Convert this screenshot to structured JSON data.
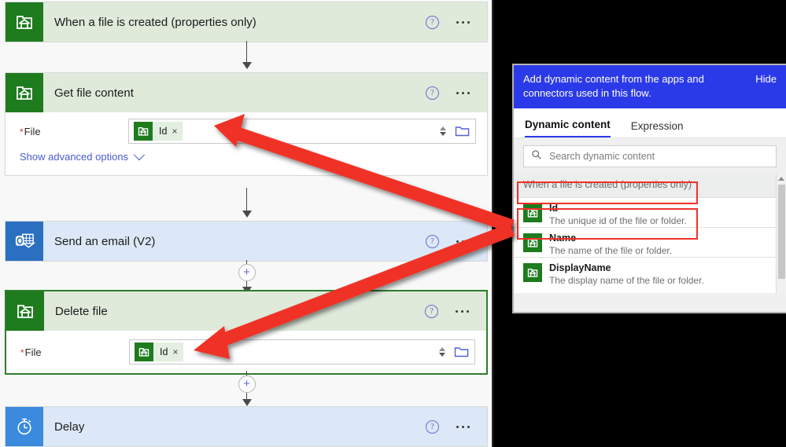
{
  "flow": {
    "steps": [
      {
        "id": "trigger",
        "title": "When a file is created (properties only)",
        "icon": "sharepoint-icon",
        "header_style": "green",
        "help_label": "?",
        "more_label": "more-options"
      },
      {
        "id": "get-file-content",
        "title": "Get file content",
        "icon": "sharepoint-icon",
        "header_style": "green",
        "field_label": "File",
        "field_required_marker": "*",
        "token_label": "Id",
        "token_remove_label": "×",
        "advanced_label": "Show advanced options",
        "folder_picker_icon": "folder-icon"
      },
      {
        "id": "send-email",
        "title": "Send an email (V2)",
        "icon": "outlook-icon",
        "header_style": "blue"
      },
      {
        "id": "delete-file",
        "title": "Delete file",
        "icon": "sharepoint-icon",
        "header_style": "green",
        "field_label": "File",
        "field_required_marker": "*",
        "token_label": "Id",
        "token_remove_label": "×",
        "folder_picker_icon": "folder-icon"
      },
      {
        "id": "delay",
        "title": "Delay",
        "icon": "stopwatch-icon",
        "header_style": "blue"
      }
    ],
    "add_step_label": "+"
  },
  "dynamic_panel": {
    "banner_text": "Add dynamic content from the apps and connectors used in this flow.",
    "hide_label": "Hide",
    "tabs": [
      {
        "label": "Dynamic content",
        "active": true
      },
      {
        "label": "Expression",
        "active": false
      }
    ],
    "search_placeholder": "Search dynamic content",
    "search_icon": "search-icon",
    "group_header": "When a file is created (properties only)",
    "items": [
      {
        "name": "Id",
        "desc": "The unique id of the file or folder.",
        "icon": "sharepoint-icon",
        "highlighted": true
      },
      {
        "name": "Name",
        "desc": "The name of the file or folder.",
        "icon": "sharepoint-icon",
        "highlighted": false
      },
      {
        "name": "DisplayName",
        "desc": "The display name of the file or folder.",
        "icon": "sharepoint-icon",
        "highlighted": false
      }
    ]
  },
  "annotations": {
    "arrow_color": "#f03226",
    "highlight_color": "#f03226",
    "arrows": [
      {
        "from": "dynamic-content-item-id",
        "to": "get-file-content-file-field"
      },
      {
        "from": "dynamic-content-item-id",
        "to": "delete-file-file-field"
      }
    ]
  },
  "colors": {
    "sharepoint_green": "#1e7b1e",
    "card_header_green": "#dfeadb",
    "card_header_blue": "#dce8f7",
    "outlook_blue": "#2a6fc0",
    "delay_blue": "#3a8ade",
    "banner_blue": "#2b3ae8",
    "link_blue": "#4a5bd0",
    "selected_border_green": "#2d7d2d",
    "required_red": "#d63b2f"
  }
}
